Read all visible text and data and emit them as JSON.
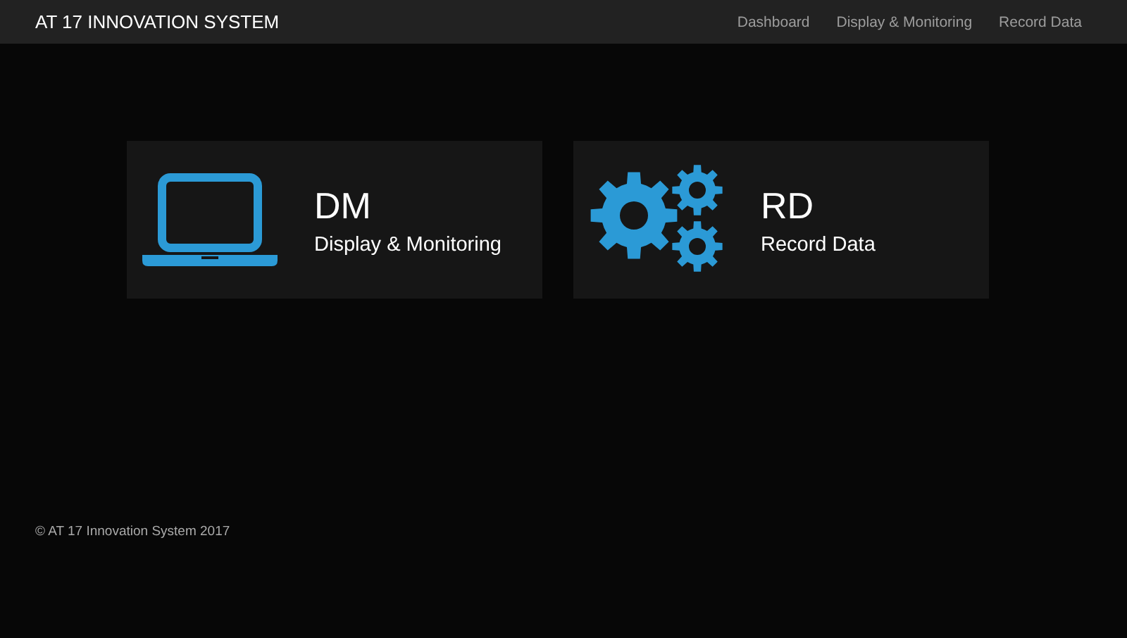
{
  "navbar": {
    "brand": "AT 17 INNOVATION SYSTEM",
    "links": [
      {
        "label": "Dashboard"
      },
      {
        "label": "Display & Monitoring"
      },
      {
        "label": "Record Data"
      }
    ]
  },
  "cards": [
    {
      "kind": "laptop",
      "code": "DM",
      "label": "Display & Monitoring"
    },
    {
      "kind": "gears",
      "code": "RD",
      "label": "Record Data"
    }
  ],
  "footer": "© AT 17 Innovation System 2017"
}
